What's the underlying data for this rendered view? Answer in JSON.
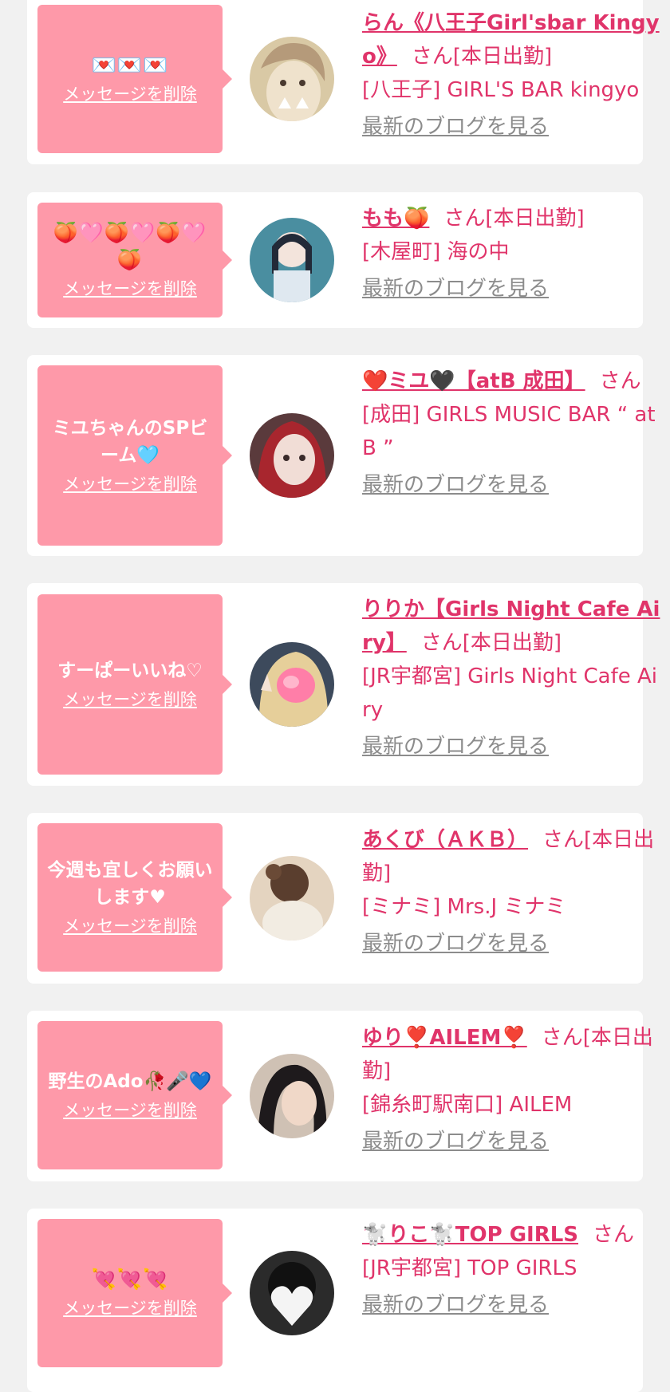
{
  "delete_label": "メッセージを削除",
  "blog_label": "最新のブログを見る",
  "colors": {
    "page_bg": "#f1f1f1",
    "card_bg": "#ffffff",
    "message_bubble": "#fe99a9",
    "accent_text": "#e0346a",
    "muted_link": "#8c8c8c"
  },
  "entries": [
    {
      "message": "",
      "message_emoji": "💌💌💌",
      "name": "らん《八王子Girl'sbar Kingyo》",
      "name_emoji": "",
      "suffix": "さん[本日出勤]",
      "shop": "[八王子] GIRL'S BAR kingyo",
      "avatar_icon": "avatar-photo-cat-ears"
    },
    {
      "message": "",
      "message_emoji": "🍑🩷🍑🩷🍑🩷🍑",
      "name": "もも",
      "name_emoji": "🍑",
      "suffix": "さん[本日出勤]",
      "shop": "[木屋町] 海の中",
      "avatar_icon": "avatar-photo"
    },
    {
      "message": "ミユちゃんのSPビーム",
      "message_emoji": "🩵",
      "name": "❤️ミユ🖤【atB 成田】",
      "name_emoji": "",
      "suffix": "さん",
      "shop": "[成田] GIRLS MUSIC BAR “ at B ”",
      "avatar_icon": "avatar-photo"
    },
    {
      "message": "すーぱーいいね♡",
      "message_emoji": "",
      "name": "りりか【Girls Night Cafe Airy】",
      "name_emoji": "",
      "suffix": "さん[本日出勤]",
      "shop": "[JR宇都宮] Girls Night Cafe Airy",
      "avatar_icon": "avatar-photo-heart"
    },
    {
      "message": "今週も宜しくお願いします♥",
      "message_emoji": "",
      "name": "あくび（ＡＫＢ）",
      "name_emoji": "",
      "suffix": "さん[本日出勤]",
      "shop": "[ミナミ] Mrs.J ミナミ",
      "avatar_icon": "avatar-photo"
    },
    {
      "message": "野生のAdo",
      "message_emoji": "🥀🎤💙",
      "name": "ゆり❣️AILEM❣️",
      "name_emoji": "",
      "suffix": "さん[本日出勤]",
      "shop": "[錦糸町駅南口] AILEM",
      "avatar_icon": "avatar-photo"
    },
    {
      "message": "",
      "message_emoji": "💘💘💘",
      "name": "🐩りこ🐩TOP GIRLS",
      "name_emoji": "",
      "suffix": "さん",
      "shop": "[JR宇都宮] TOP GIRLS",
      "avatar_icon": "avatar-photo-heart"
    }
  ]
}
